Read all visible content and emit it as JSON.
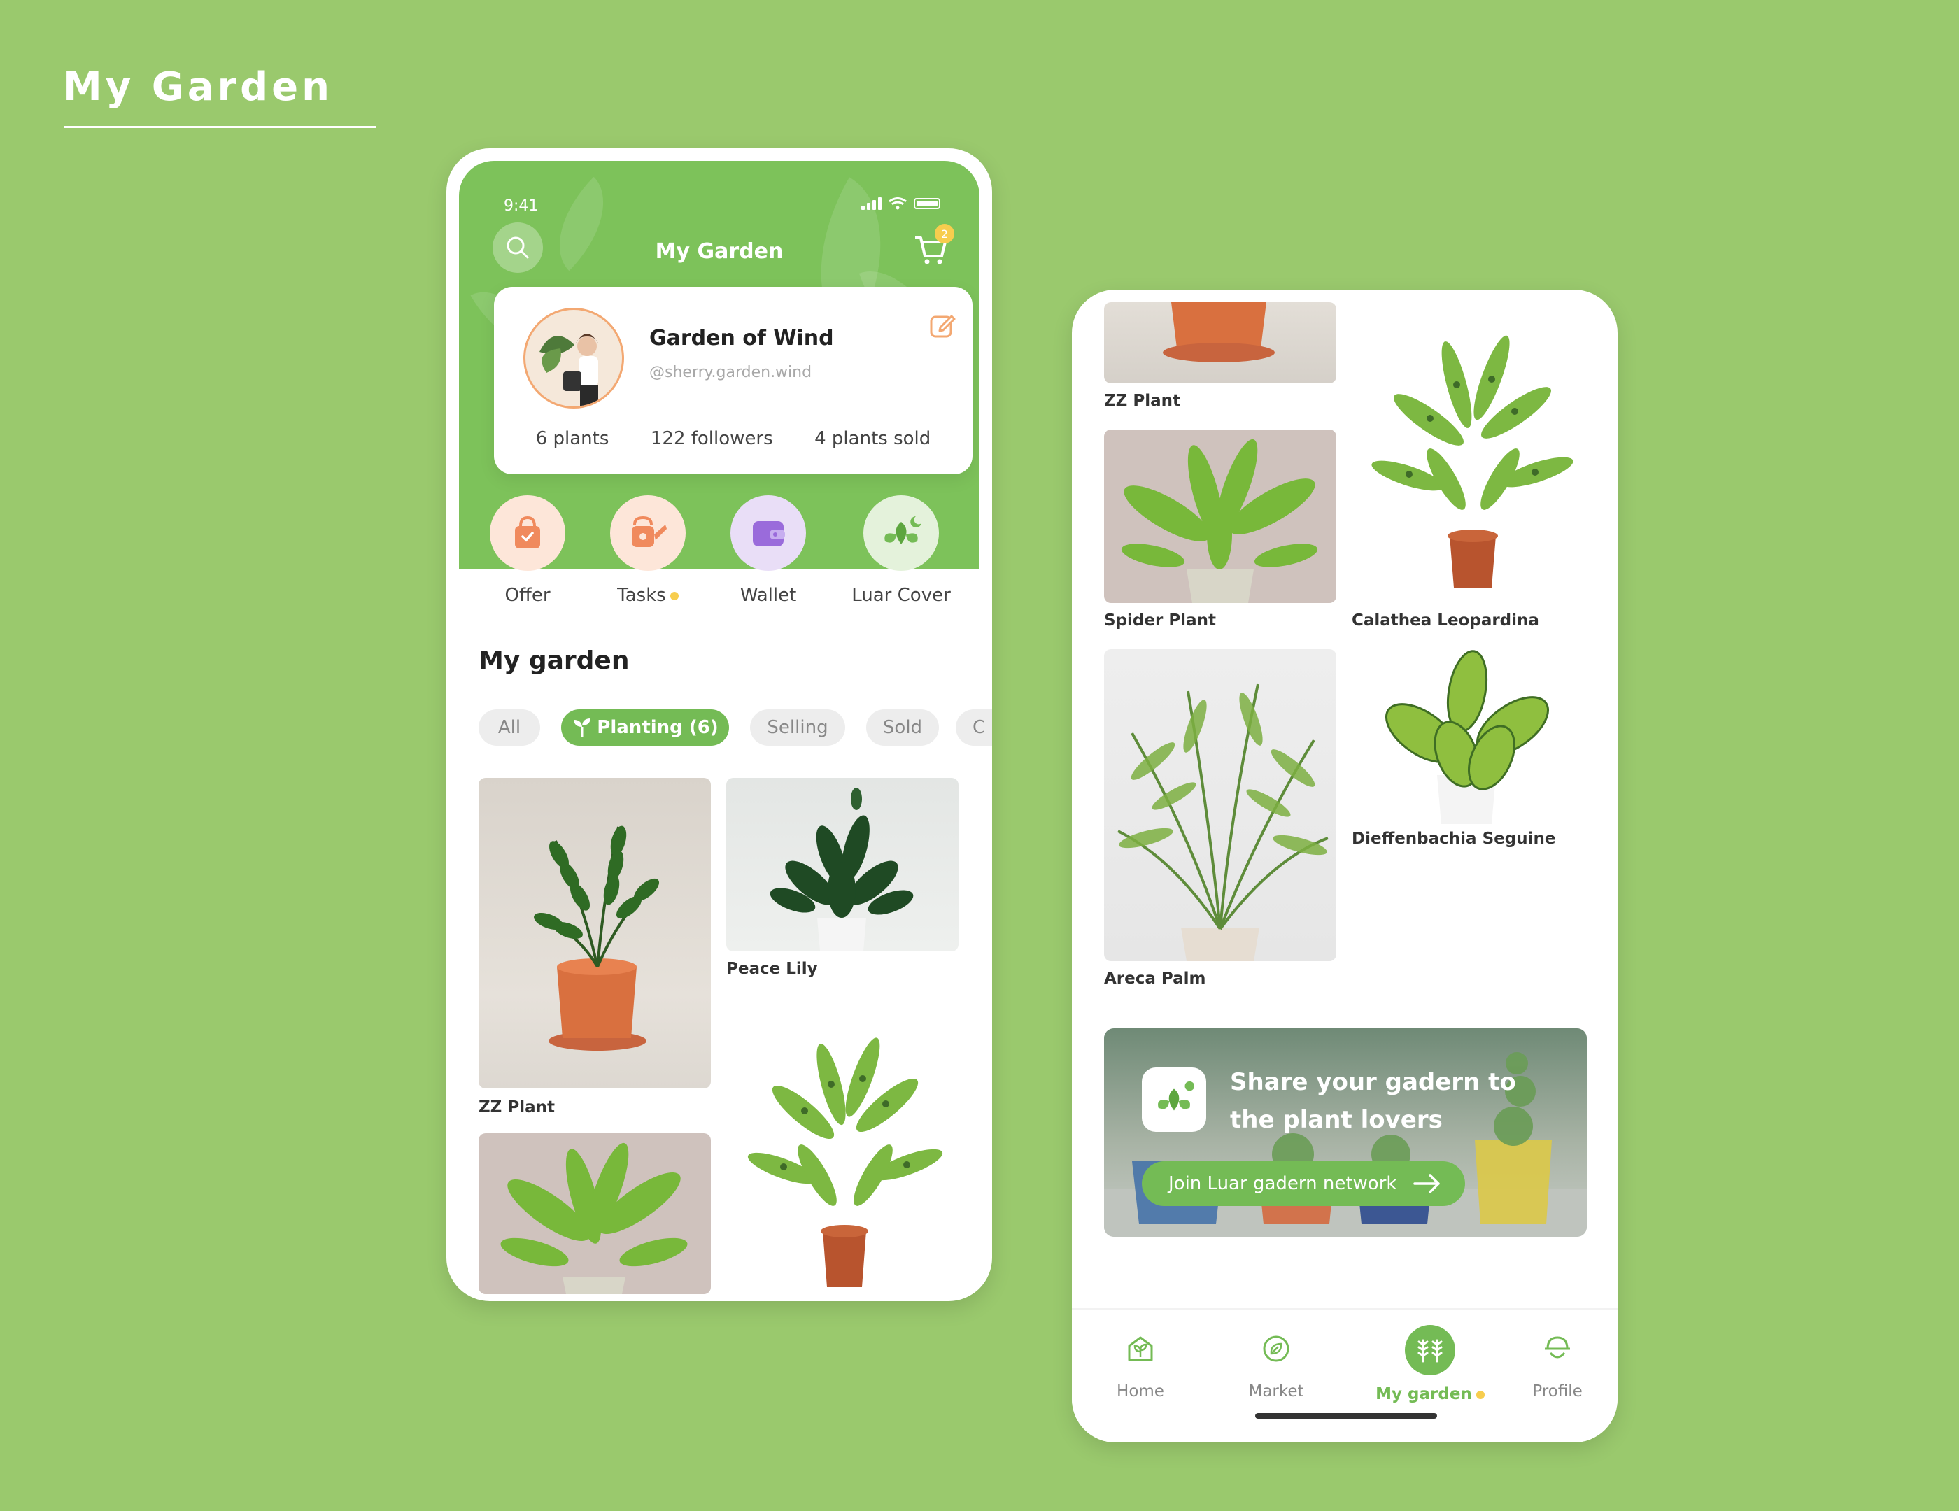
{
  "page": {
    "title": "My Garden"
  },
  "phone1": {
    "status": {
      "time": "9:41"
    },
    "header": {
      "title": "My Garden",
      "cart_count": "2"
    },
    "profile": {
      "name": "Garden of Wind",
      "handle": "@sherry.garden.wind",
      "stats": [
        "6 plants",
        "122 followers",
        "4 plants sold"
      ]
    },
    "actions": [
      {
        "label": "Offer",
        "icon": "shopping-bag-icon",
        "color": "#F08A5D",
        "bg": "#FDE6D9"
      },
      {
        "label": "Tasks",
        "icon": "watering-can-icon",
        "color": "#F08A5D",
        "bg": "#FDE6D9"
      },
      {
        "label": "Wallet",
        "icon": "wallet-icon",
        "color": "#9A6BDB",
        "bg": "#E9DEF7"
      },
      {
        "label": "Luar Cover",
        "icon": "leaf-moon-icon",
        "color": "#74BB55",
        "bg": "#E4F2DB"
      }
    ],
    "section_title": "My garden",
    "filters": [
      "All",
      "Planting (6)",
      "Selling",
      "Sold",
      "C"
    ],
    "plants": [
      {
        "name": "ZZ Plant"
      },
      {
        "name": "Peace Lily"
      }
    ]
  },
  "phone2": {
    "plants": [
      {
        "name": "ZZ Plant"
      },
      {
        "name": "Spider Plant"
      },
      {
        "name": "Calathea Leopardina"
      },
      {
        "name": "Areca Palm"
      },
      {
        "name": "Dieffenbachia Seguine"
      }
    ],
    "banner": {
      "title": "Share your gadern to the plant lovers",
      "cta": "Join Luar gadern network"
    },
    "nav": [
      {
        "label": "Home",
        "icon": "home-plant-icon"
      },
      {
        "label": "Market",
        "icon": "leaf-circle-icon"
      },
      {
        "label": "My garden",
        "icon": "garden-icon"
      },
      {
        "label": "Profile",
        "icon": "profile-hat-icon"
      }
    ]
  },
  "colors": {
    "background": "#9AC96D",
    "primary": "#74BB55",
    "accent": "#F7CD4E"
  }
}
